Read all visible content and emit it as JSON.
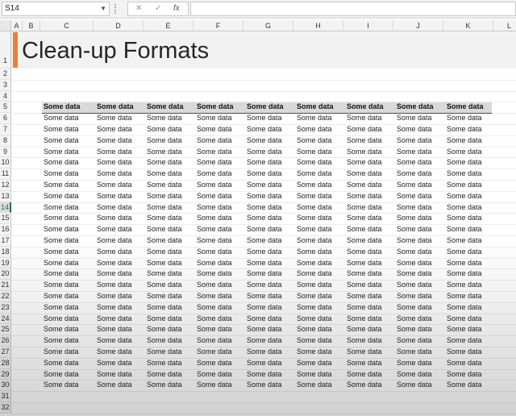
{
  "formula_bar": {
    "name_box": "S14",
    "cancel_glyph": "✕",
    "enter_glyph": "✓",
    "fx_label": "fx",
    "formula": ""
  },
  "columns": [
    "A",
    "B",
    "C",
    "D",
    "E",
    "F",
    "G",
    "H",
    "I",
    "J",
    "K",
    "L"
  ],
  "rows": [
    "1",
    "2",
    "3",
    "4",
    "5",
    "6",
    "7",
    "8",
    "9",
    "10",
    "11",
    "12",
    "13",
    "14",
    "15",
    "16",
    "17",
    "18",
    "19",
    "20",
    "21",
    "22",
    "23",
    "24",
    "25",
    "26",
    "27",
    "28",
    "29",
    "30",
    "31",
    "32"
  ],
  "active_row": "14",
  "title": "Clean-up Formats",
  "accent_color": "#e8803a",
  "table": {
    "header": [
      "Some data",
      "Some data",
      "Some data",
      "Some data",
      "Some data",
      "Some data",
      "Some data",
      "Some data",
      "Some data"
    ],
    "body_rows": [
      [
        "Some data",
        "Some data",
        "Some data",
        "Some data",
        "Some data",
        "Some data",
        "Some data",
        "Some data",
        "Some data"
      ],
      [
        "Some data",
        "Some data",
        "Some data",
        "Some data",
        "Some data",
        "Some data",
        "Some data",
        "Some data",
        "Some data"
      ],
      [
        "Some data",
        "Some data",
        "Some data",
        "Some data",
        "Some data",
        "Some data",
        "Some data",
        "Some data",
        "Some data"
      ],
      [
        "Some data",
        "Some data",
        "Some data",
        "Some data",
        "Some data",
        "Some data",
        "Some data",
        "Some data",
        "Some data"
      ],
      [
        "Some data",
        "Some data",
        "Some data",
        "Some data",
        "Some data",
        "Some data",
        "Some data",
        "Some data",
        "Some data"
      ],
      [
        "Some data",
        "Some data",
        "Some data",
        "Some data",
        "Some data",
        "Some data",
        "Some data",
        "Some data",
        "Some data"
      ],
      [
        "Some data",
        "Some data",
        "Some data",
        "Some data",
        "Some data",
        "Some data",
        "Some data",
        "Some data",
        "Some data"
      ],
      [
        "Some data",
        "Some data",
        "Some data",
        "Some data",
        "Some data",
        "Some data",
        "Some data",
        "Some data",
        "Some data"
      ],
      [
        "Some data",
        "Some data",
        "Some data",
        "Some data",
        "Some data",
        "Some data",
        "Some data",
        "Some data",
        "Some data"
      ],
      [
        "Some data",
        "Some data",
        "Some data",
        "Some data",
        "Some data",
        "Some data",
        "Some data",
        "Some data",
        "Some data"
      ],
      [
        "Some data",
        "Some data",
        "Some data",
        "Some data",
        "Some data",
        "Some data",
        "Some data",
        "Some data",
        "Some data"
      ],
      [
        "Some data",
        "Some data",
        "Some data",
        "Some data",
        "Some data",
        "Some data",
        "Some data",
        "Some data",
        "Some data"
      ],
      [
        "Some data",
        "Some data",
        "Some data",
        "Some data",
        "Some data",
        "Some data",
        "Some data",
        "Some data",
        "Some data"
      ],
      [
        "Some data",
        "Some data",
        "Some data",
        "Some data",
        "Some data",
        "Some data",
        "Some data",
        "Some data",
        "Some data"
      ],
      [
        "Some data",
        "Some data",
        "Some data",
        "Some data",
        "Some data",
        "Some data",
        "Some data",
        "Some data",
        "Some data"
      ],
      [
        "Some data",
        "Some data",
        "Some data",
        "Some data",
        "Some data",
        "Some data",
        "Some data",
        "Some data",
        "Some data"
      ],
      [
        "Some data",
        "Some data",
        "Some data",
        "Some data",
        "Some data",
        "Some data",
        "Some data",
        "Some data",
        "Some data"
      ],
      [
        "Some data",
        "Some data",
        "Some data",
        "Some data",
        "Some data",
        "Some data",
        "Some data",
        "Some data",
        "Some data"
      ],
      [
        "Some data",
        "Some data",
        "Some data",
        "Some data",
        "Some data",
        "Some data",
        "Some data",
        "Some data",
        "Some data"
      ],
      [
        "Some data",
        "Some data",
        "Some data",
        "Some data",
        "Some data",
        "Some data",
        "Some data",
        "Some data",
        "Some data"
      ],
      [
        "Some data",
        "Some data",
        "Some data",
        "Some data",
        "Some data",
        "Some data",
        "Some data",
        "Some data",
        "Some data"
      ],
      [
        "Some data",
        "Some data",
        "Some data",
        "Some data",
        "Some data",
        "Some data",
        "Some data",
        "Some data",
        "Some data"
      ],
      [
        "Some data",
        "Some data",
        "Some data",
        "Some data",
        "Some data",
        "Some data",
        "Some data",
        "Some data",
        "Some data"
      ],
      [
        "Some data",
        "Some data",
        "Some data",
        "Some data",
        "Some data",
        "Some data",
        "Some data",
        "Some data",
        "Some data"
      ],
      [
        "Some data",
        "Some data",
        "Some data",
        "Some data",
        "Some data",
        "Some data",
        "Some data",
        "Some data",
        "Some data"
      ]
    ]
  }
}
